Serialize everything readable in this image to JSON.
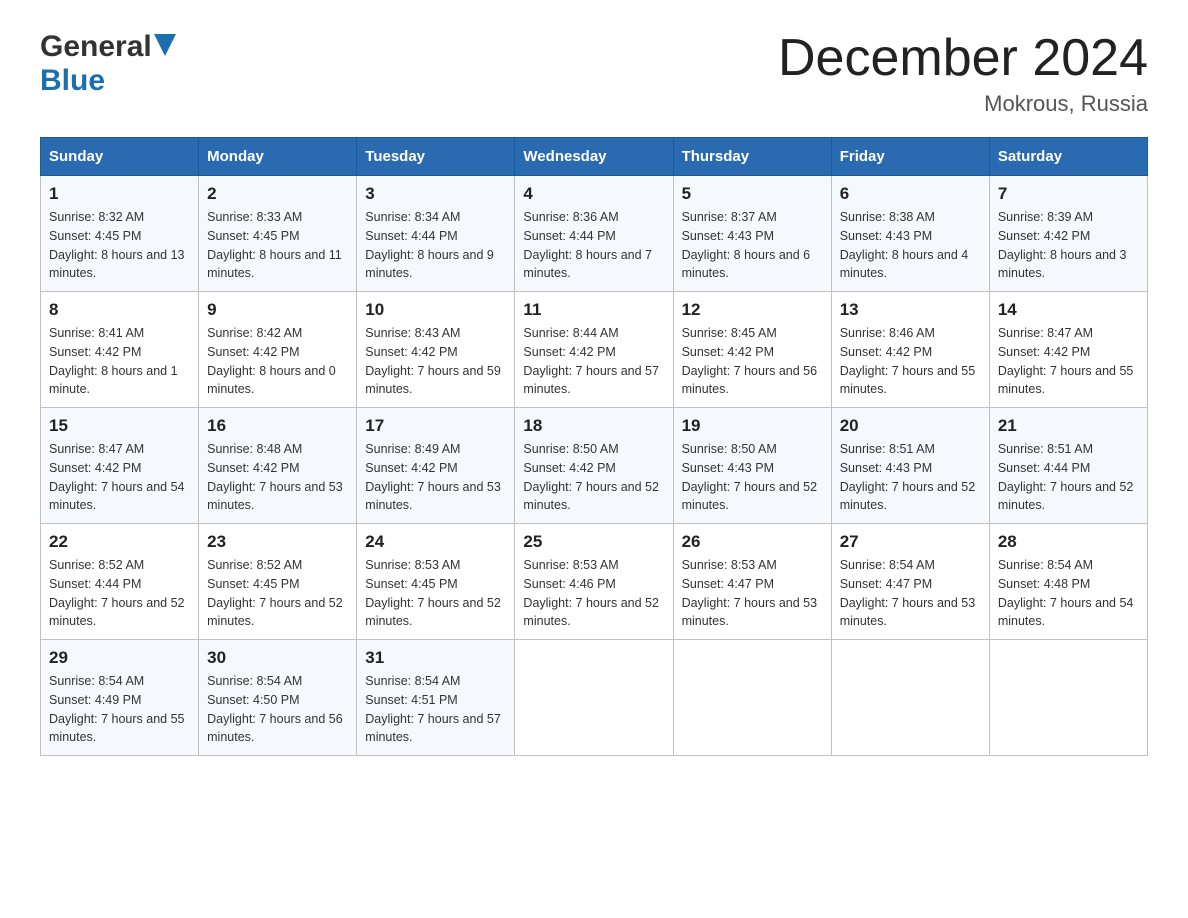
{
  "header": {
    "logo": {
      "general": "General",
      "blue": "Blue",
      "triangle_color": "#1a6faf"
    },
    "title": "December 2024",
    "subtitle": "Mokrous, Russia"
  },
  "weekdays": [
    "Sunday",
    "Monday",
    "Tuesday",
    "Wednesday",
    "Thursday",
    "Friday",
    "Saturday"
  ],
  "weeks": [
    [
      {
        "day": "1",
        "sunrise": "8:32 AM",
        "sunset": "4:45 PM",
        "daylight": "8 hours and 13 minutes."
      },
      {
        "day": "2",
        "sunrise": "8:33 AM",
        "sunset": "4:45 PM",
        "daylight": "8 hours and 11 minutes."
      },
      {
        "day": "3",
        "sunrise": "8:34 AM",
        "sunset": "4:44 PM",
        "daylight": "8 hours and 9 minutes."
      },
      {
        "day": "4",
        "sunrise": "8:36 AM",
        "sunset": "4:44 PM",
        "daylight": "8 hours and 7 minutes."
      },
      {
        "day": "5",
        "sunrise": "8:37 AM",
        "sunset": "4:43 PM",
        "daylight": "8 hours and 6 minutes."
      },
      {
        "day": "6",
        "sunrise": "8:38 AM",
        "sunset": "4:43 PM",
        "daylight": "8 hours and 4 minutes."
      },
      {
        "day": "7",
        "sunrise": "8:39 AM",
        "sunset": "4:42 PM",
        "daylight": "8 hours and 3 minutes."
      }
    ],
    [
      {
        "day": "8",
        "sunrise": "8:41 AM",
        "sunset": "4:42 PM",
        "daylight": "8 hours and 1 minute."
      },
      {
        "day": "9",
        "sunrise": "8:42 AM",
        "sunset": "4:42 PM",
        "daylight": "8 hours and 0 minutes."
      },
      {
        "day": "10",
        "sunrise": "8:43 AM",
        "sunset": "4:42 PM",
        "daylight": "7 hours and 59 minutes."
      },
      {
        "day": "11",
        "sunrise": "8:44 AM",
        "sunset": "4:42 PM",
        "daylight": "7 hours and 57 minutes."
      },
      {
        "day": "12",
        "sunrise": "8:45 AM",
        "sunset": "4:42 PM",
        "daylight": "7 hours and 56 minutes."
      },
      {
        "day": "13",
        "sunrise": "8:46 AM",
        "sunset": "4:42 PM",
        "daylight": "7 hours and 55 minutes."
      },
      {
        "day": "14",
        "sunrise": "8:47 AM",
        "sunset": "4:42 PM",
        "daylight": "7 hours and 55 minutes."
      }
    ],
    [
      {
        "day": "15",
        "sunrise": "8:47 AM",
        "sunset": "4:42 PM",
        "daylight": "7 hours and 54 minutes."
      },
      {
        "day": "16",
        "sunrise": "8:48 AM",
        "sunset": "4:42 PM",
        "daylight": "7 hours and 53 minutes."
      },
      {
        "day": "17",
        "sunrise": "8:49 AM",
        "sunset": "4:42 PM",
        "daylight": "7 hours and 53 minutes."
      },
      {
        "day": "18",
        "sunrise": "8:50 AM",
        "sunset": "4:42 PM",
        "daylight": "7 hours and 52 minutes."
      },
      {
        "day": "19",
        "sunrise": "8:50 AM",
        "sunset": "4:43 PM",
        "daylight": "7 hours and 52 minutes."
      },
      {
        "day": "20",
        "sunrise": "8:51 AM",
        "sunset": "4:43 PM",
        "daylight": "7 hours and 52 minutes."
      },
      {
        "day": "21",
        "sunrise": "8:51 AM",
        "sunset": "4:44 PM",
        "daylight": "7 hours and 52 minutes."
      }
    ],
    [
      {
        "day": "22",
        "sunrise": "8:52 AM",
        "sunset": "4:44 PM",
        "daylight": "7 hours and 52 minutes."
      },
      {
        "day": "23",
        "sunrise": "8:52 AM",
        "sunset": "4:45 PM",
        "daylight": "7 hours and 52 minutes."
      },
      {
        "day": "24",
        "sunrise": "8:53 AM",
        "sunset": "4:45 PM",
        "daylight": "7 hours and 52 minutes."
      },
      {
        "day": "25",
        "sunrise": "8:53 AM",
        "sunset": "4:46 PM",
        "daylight": "7 hours and 52 minutes."
      },
      {
        "day": "26",
        "sunrise": "8:53 AM",
        "sunset": "4:47 PM",
        "daylight": "7 hours and 53 minutes."
      },
      {
        "day": "27",
        "sunrise": "8:54 AM",
        "sunset": "4:47 PM",
        "daylight": "7 hours and 53 minutes."
      },
      {
        "day": "28",
        "sunrise": "8:54 AM",
        "sunset": "4:48 PM",
        "daylight": "7 hours and 54 minutes."
      }
    ],
    [
      {
        "day": "29",
        "sunrise": "8:54 AM",
        "sunset": "4:49 PM",
        "daylight": "7 hours and 55 minutes."
      },
      {
        "day": "30",
        "sunrise": "8:54 AM",
        "sunset": "4:50 PM",
        "daylight": "7 hours and 56 minutes."
      },
      {
        "day": "31",
        "sunrise": "8:54 AM",
        "sunset": "4:51 PM",
        "daylight": "7 hours and 57 minutes."
      },
      null,
      null,
      null,
      null
    ]
  ],
  "labels": {
    "sunrise": "Sunrise: ",
    "sunset": "Sunset: ",
    "daylight": "Daylight: "
  }
}
